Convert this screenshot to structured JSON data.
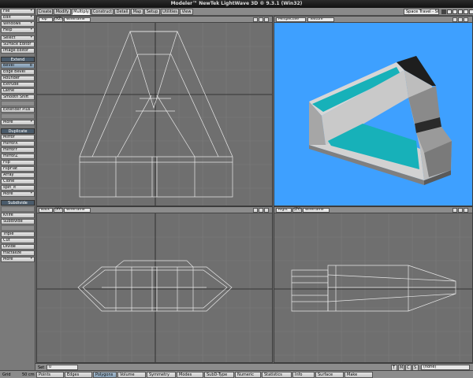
{
  "window": {
    "title": "Modeler™ NewTek LightWave 3D ® 9.3.1 (Win32)"
  },
  "tabs": [
    "Create",
    "Modify",
    "Multiply",
    "Construct",
    "Detail",
    "Map",
    "Setup",
    "Utilities",
    "View"
  ],
  "active_tab": "Multiply",
  "object_select": "Space Travel - Ship",
  "sidebar": {
    "top_buttons": [
      "File",
      "Edit",
      "Windows",
      "Help"
    ],
    "tools": [
      "Select",
      "Surface Editor",
      "Image Editor"
    ],
    "extend": {
      "header": "Extend",
      "items": [
        "Bevel",
        "Edge Bevel",
        "Rounder",
        "Extrude",
        "Lathe",
        "Smooth Shift"
      ],
      "selected": "Bevel",
      "selected_shortcut": "b",
      "after": [
        "Extender Plus"
      ],
      "more": "More"
    },
    "duplicate": {
      "header": "Duplicate",
      "items": [
        "Mirror",
        "mirrorX",
        "mirrorY",
        "mirrorZ",
        "Flip",
        "FlipFlat",
        "Array",
        "Clone",
        "spin_it"
      ],
      "more": "More"
    },
    "subdivide": {
      "header": "Subdivide",
      "items": [
        "Knife",
        "Subdivide",
        "Triple",
        "Cut",
        "Divide",
        "fractalize"
      ],
      "more": "More"
    }
  },
  "viewports": [
    {
      "name": "Top",
      "axes": "(XZ)",
      "mode": "Wireframe"
    },
    {
      "name": "Perspective",
      "axes": "",
      "mode": "Texture"
    },
    {
      "name": "Back",
      "axes": "(XY)",
      "mode": "Wireframe"
    },
    {
      "name": "Right",
      "axes": "(ZY)",
      "mode": "Wireframe"
    }
  ],
  "status": {
    "set_label": "Set",
    "set_value": "0",
    "grid_label": "Grid",
    "grid_value": "50 cm",
    "channels": [
      "T",
      "M",
      "C",
      "S"
    ],
    "morph_select": "(none)"
  },
  "modes": [
    "Points",
    "Edges",
    "Polygons",
    "Volume",
    "Symmetry",
    "Modes",
    "SubD-Type",
    "Numeric",
    "Statistics",
    "Info",
    "Surface",
    "Make"
  ],
  "active_mode": "Polygons",
  "colors": {
    "sky": "#3ea0ff",
    "teal": "#17b1b9",
    "hull": "#c8c8c8",
    "wire": "#e8e8e8"
  }
}
